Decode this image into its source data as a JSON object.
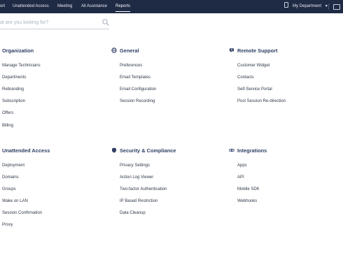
{
  "nav": {
    "items": [
      {
        "label": "ort",
        "active": false
      },
      {
        "label": "Unattended Access",
        "active": false
      },
      {
        "label": "Meeting",
        "active": false
      },
      {
        "label": "All Assistance",
        "active": false
      },
      {
        "label": "Reports",
        "active": true
      }
    ],
    "department_label": "My Department",
    "department_caret": "▾"
  },
  "search": {
    "placeholder": "at are you looking for?"
  },
  "sections": {
    "organization": {
      "title": "Organization",
      "links": [
        "Manage Technicians",
        "Departments",
        "Rebranding",
        "Subscription",
        "Offers",
        "Billing"
      ]
    },
    "general": {
      "title": "General",
      "icon": "globe-icon",
      "links": [
        "Preferences",
        "Email Templates",
        "Email Configuration",
        "Session Recording"
      ]
    },
    "remote_support": {
      "title": "Remote Support",
      "icon": "chat-shield-icon",
      "links": [
        "Customer Widget",
        "Contacts",
        "Self-Service Portal",
        "Post Session Re-direction"
      ]
    },
    "unattended_access": {
      "title": "Unattended Access",
      "links": [
        "Deployment",
        "Domains",
        "Groups",
        "Wake on LAN",
        "Session Confirmation",
        "Proxy"
      ]
    },
    "security": {
      "title": "Security & Compliance",
      "icon": "shield-icon",
      "links": [
        "Privacy Settings",
        "Action Log Viewer",
        "Two-factor Authentication",
        "IP Based Restriction",
        "Data Cleanup"
      ]
    },
    "integrations": {
      "title": "Integrations",
      "icon": "link-icon",
      "links": [
        "Apps",
        "API",
        "Mobile SDK",
        "Webhooks"
      ]
    }
  },
  "colors": {
    "topbar": "#1f2a44",
    "section_title": "#2e3f63",
    "link": "#2f3848",
    "search_line": "#c7d0dc"
  }
}
